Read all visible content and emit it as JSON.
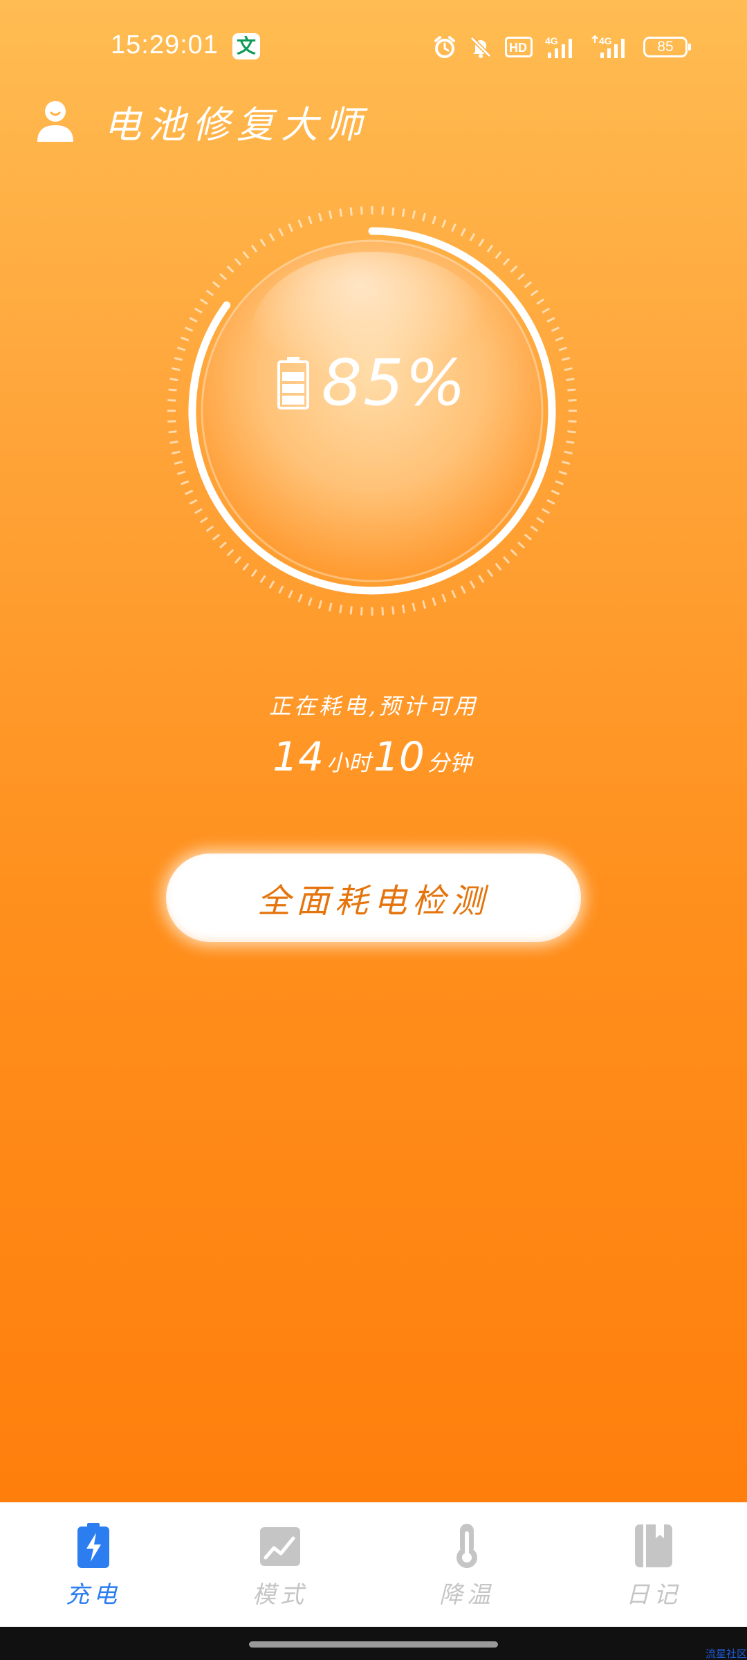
{
  "status_bar": {
    "time": "15:29:01",
    "app_glyph": "文",
    "battery_level": "85",
    "icons": [
      "alarm-icon",
      "mute-bell-icon",
      "hd-icon",
      "signal-4g-icon",
      "signal-4g-icon",
      "battery-icon"
    ],
    "hd_label": "HD",
    "network_label": "4G"
  },
  "header": {
    "title": "电池修复大师",
    "icon": "user-icon"
  },
  "gauge": {
    "percent_text": "85%",
    "level": 0.85,
    "icon": "battery-icon",
    "colors": {
      "ring": "#ffffff",
      "sphere_inner": "#ffd19a",
      "sphere_edge": "#ff9a2e"
    }
  },
  "estimate": {
    "status": "正在耗电,预计可用",
    "hours": "14",
    "hours_unit": "小时",
    "minutes": "10",
    "minutes_unit": "分钟"
  },
  "detect_button": {
    "label": "全面耗电检测",
    "color": "#e5740d"
  },
  "bottom_nav": {
    "active_color": "#2b7df0",
    "inactive_color": "#c5c5c5",
    "items": [
      {
        "label": "充电",
        "icon": "charge-icon",
        "active": true
      },
      {
        "label": "模式",
        "icon": "chart-image-icon",
        "active": false
      },
      {
        "label": "降温",
        "icon": "thermometer-icon",
        "active": false
      },
      {
        "label": "日记",
        "icon": "notebook-icon",
        "active": false
      }
    ]
  },
  "watermark": "流星社区"
}
